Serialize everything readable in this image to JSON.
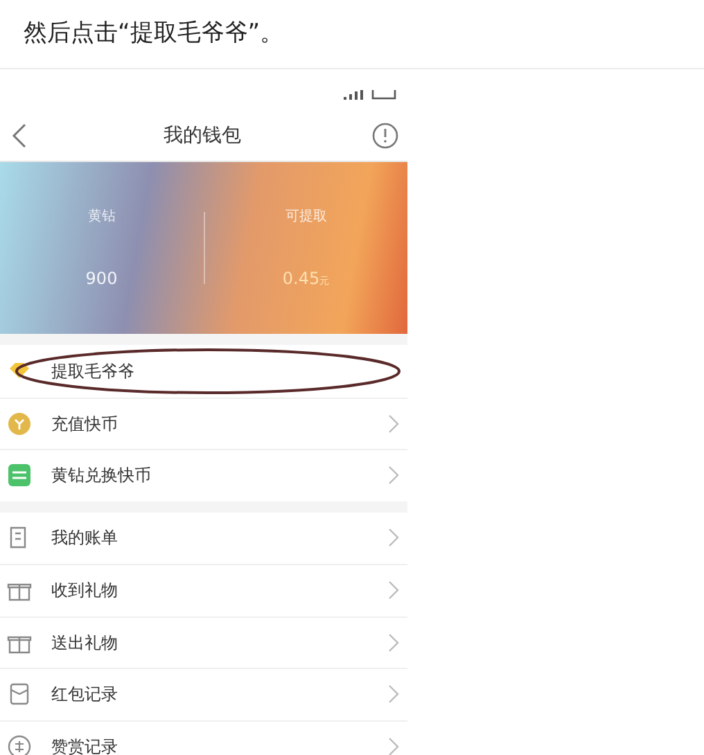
{
  "caption": "然后点击“提取毛爷爷”。",
  "phone": {
    "title": "我的钱包",
    "balances": [
      {
        "label": "黄钻",
        "value": "900"
      },
      {
        "label": "可提取",
        "value": "0.45",
        "unit": "元"
      }
    ],
    "groups": [
      [
        {
          "kind": "diamond",
          "label": "提取毛爷爷",
          "circled": true,
          "chevron": false
        },
        {
          "kind": "coin",
          "label": "充值快币",
          "circled": false,
          "chevron": true
        },
        {
          "kind": "exchange",
          "label": "黄钻兑换快币",
          "circled": false,
          "chevron": true
        }
      ],
      [
        {
          "kind": "bill",
          "label": "我的账单",
          "circled": false,
          "chevron": true
        },
        {
          "kind": "gift",
          "label": "收到礼物",
          "circled": false,
          "chevron": true
        },
        {
          "kind": "gift",
          "label": "送出礼物",
          "circled": false,
          "chevron": true
        },
        {
          "kind": "envelope",
          "label": "红包记录",
          "circled": false,
          "chevron": true
        },
        {
          "kind": "award",
          "label": "赞赏记录",
          "circled": false,
          "chevron": true
        }
      ]
    ]
  }
}
